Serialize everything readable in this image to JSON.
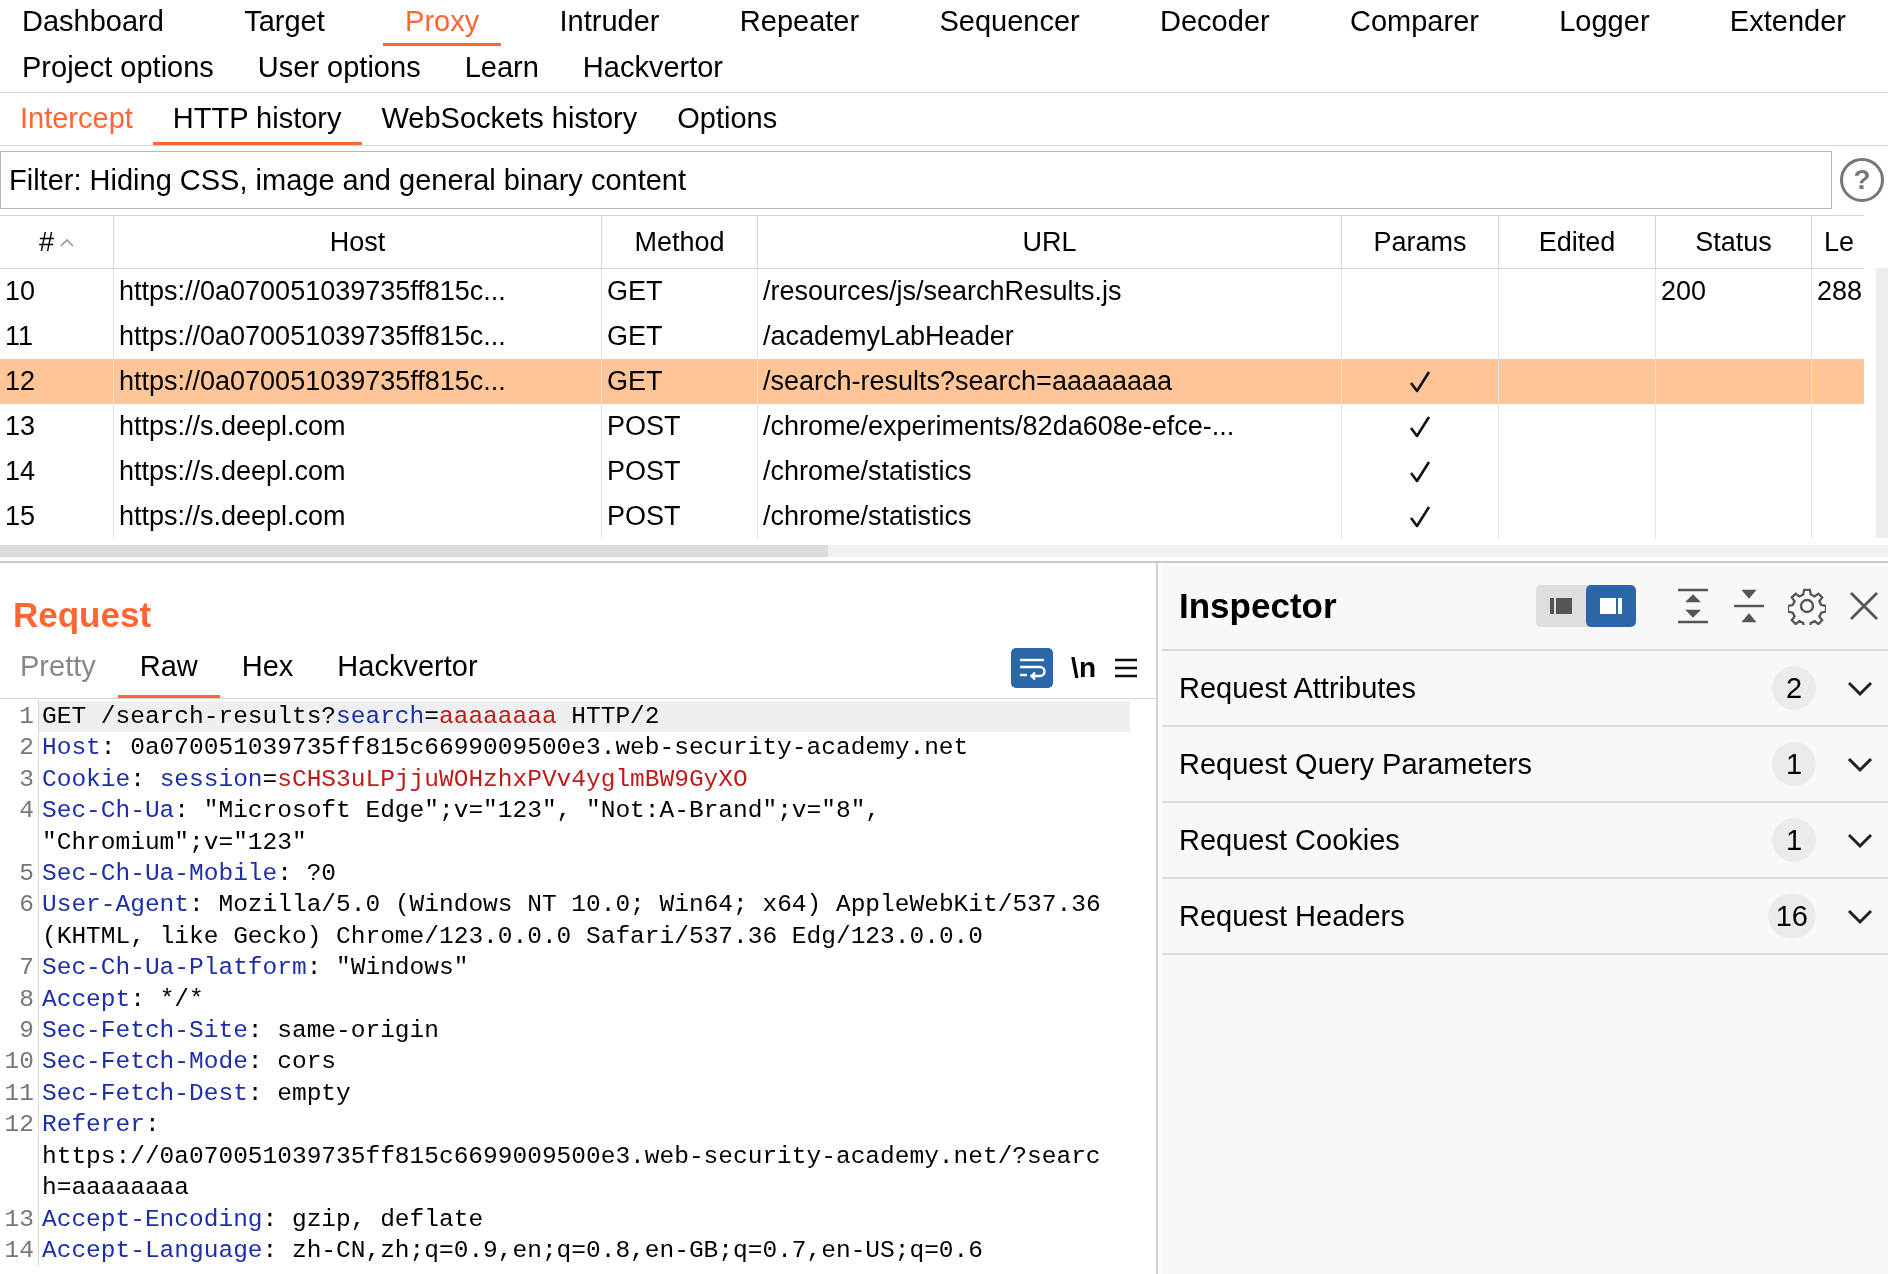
{
  "main_tabs": {
    "rows": [
      {
        "tabs": [
          {
            "label": "Dashboard",
            "selected": false
          },
          {
            "label": "Target",
            "selected": false
          },
          {
            "label": "Proxy",
            "selected": true
          },
          {
            "label": "Intruder",
            "selected": false
          },
          {
            "label": "Repeater",
            "selected": false
          },
          {
            "label": "Sequencer",
            "selected": false
          },
          {
            "label": "Decoder",
            "selected": false
          },
          {
            "label": "Comparer",
            "selected": false
          },
          {
            "label": "Logger",
            "selected": false
          },
          {
            "label": "Extender",
            "selected": false
          }
        ]
      },
      {
        "tabs": [
          {
            "label": "Project options",
            "selected": false
          },
          {
            "label": "User options",
            "selected": false
          },
          {
            "label": "Learn",
            "selected": false
          },
          {
            "label": "Hackvertor",
            "selected": false
          }
        ]
      }
    ]
  },
  "proxy_tabs": [
    {
      "label": "Intercept",
      "selected": false,
      "alert": true
    },
    {
      "label": "HTTP history",
      "selected": true,
      "alert": false
    },
    {
      "label": "WebSockets history",
      "selected": false,
      "alert": false
    },
    {
      "label": "Options",
      "selected": false,
      "alert": false
    }
  ],
  "filter": {
    "text": "Filter: Hiding CSS, image and general binary content",
    "help": "?"
  },
  "history": {
    "columns": [
      {
        "label": "#",
        "sorted": true
      },
      {
        "label": "Host",
        "sorted": false
      },
      {
        "label": "Method",
        "sorted": false
      },
      {
        "label": "URL",
        "sorted": false
      },
      {
        "label": "Params",
        "sorted": false
      },
      {
        "label": "Edited",
        "sorted": false
      },
      {
        "label": "Status",
        "sorted": false
      },
      {
        "label": "Le",
        "sorted": false
      }
    ],
    "rows": [
      {
        "number": "10",
        "host": "https://0a070051039735ff815c...",
        "method": "GET",
        "url": "/resources/js/searchResults.js",
        "params": false,
        "status": "200",
        "length": "288",
        "selected": false
      },
      {
        "number": "11",
        "host": "https://0a070051039735ff815c...",
        "method": "GET",
        "url": "/academyLabHeader",
        "params": false,
        "selected": false
      },
      {
        "number": "12",
        "host": "https://0a070051039735ff815c...",
        "method": "GET",
        "url": "/search-results?search=aaaaaaaa",
        "params": true,
        "selected": true
      },
      {
        "number": "13",
        "host": "https://s.deepl.com",
        "method": "POST",
        "url": "/chrome/experiments/82da608e-efce-...",
        "params": true,
        "selected": false
      },
      {
        "number": "14",
        "host": "https://s.deepl.com",
        "method": "POST",
        "url": "/chrome/statistics",
        "params": true,
        "selected": false
      },
      {
        "number": "15",
        "host": "https://s.deepl.com",
        "method": "POST",
        "url": "/chrome/statistics",
        "params": true,
        "selected": false
      }
    ]
  },
  "request": {
    "title": "Request",
    "tabs": [
      {
        "label": "Pretty",
        "selected": false,
        "disabled": true
      },
      {
        "label": "Raw",
        "selected": true,
        "disabled": false
      },
      {
        "label": "Hex",
        "selected": false,
        "disabled": false
      },
      {
        "label": "Hackvertor",
        "selected": false,
        "disabled": false
      }
    ],
    "wrap_on": true,
    "newline_label": "\\n",
    "lines": [
      {
        "number": "1",
        "current": true,
        "segments": [
          {
            "kind": "plain",
            "text": "GET /search-results?"
          },
          {
            "kind": "param",
            "text": "search"
          },
          {
            "kind": "plain",
            "text": "="
          },
          {
            "kind": "value",
            "text": "aaaaaaaa"
          },
          {
            "kind": "plain",
            "text": " HTTP/2"
          }
        ]
      },
      {
        "number": "2",
        "current": false,
        "segments": [
          {
            "kind": "name",
            "text": "Host"
          },
          {
            "kind": "plain",
            "text": ": 0a070051039735ff815c6699009500e3.web-security-academy.net"
          }
        ]
      },
      {
        "number": "3",
        "current": false,
        "segments": [
          {
            "kind": "name",
            "text": "Cookie"
          },
          {
            "kind": "plain",
            "text": ": "
          },
          {
            "kind": "param",
            "text": "session"
          },
          {
            "kind": "plain",
            "text": "="
          },
          {
            "kind": "value",
            "text": "sCHS3uLPjjuWOHzhxPVv4yglmBW9GyXO"
          }
        ]
      },
      {
        "number": "4",
        "current": false,
        "segments": [
          {
            "kind": "name",
            "text": "Sec-Ch-Ua"
          },
          {
            "kind": "plain",
            "text": ": \"Microsoft Edge\";v=\"123\", \"Not:A-Brand\";v=\"8\", \"Chromium\";v=\"123\""
          }
        ]
      },
      {
        "number": "5",
        "current": false,
        "segments": [
          {
            "kind": "name",
            "text": "Sec-Ch-Ua-Mobile"
          },
          {
            "kind": "plain",
            "text": ": ?0"
          }
        ]
      },
      {
        "number": "6",
        "current": false,
        "segments": [
          {
            "kind": "name",
            "text": "User-Agent"
          },
          {
            "kind": "plain",
            "text": ": Mozilla/5.0 (Windows NT 10.0; Win64; x64) AppleWebKit/537.36 (KHTML, like Gecko) Chrome/123.0.0.0 Safari/537.36 Edg/123.0.0.0"
          }
        ]
      },
      {
        "number": "7",
        "current": false,
        "segments": [
          {
            "kind": "name",
            "text": "Sec-Ch-Ua-Platform"
          },
          {
            "kind": "plain",
            "text": ": \"Windows\""
          }
        ]
      },
      {
        "number": "8",
        "current": false,
        "segments": [
          {
            "kind": "name",
            "text": "Accept"
          },
          {
            "kind": "plain",
            "text": ": */*"
          }
        ]
      },
      {
        "number": "9",
        "current": false,
        "segments": [
          {
            "kind": "name",
            "text": "Sec-Fetch-Site"
          },
          {
            "kind": "plain",
            "text": ": same-origin"
          }
        ]
      },
      {
        "number": "10",
        "current": false,
        "segments": [
          {
            "kind": "name",
            "text": "Sec-Fetch-Mode"
          },
          {
            "kind": "plain",
            "text": ": cors"
          }
        ]
      },
      {
        "number": "11",
        "current": false,
        "segments": [
          {
            "kind": "name",
            "text": "Sec-Fetch-Dest"
          },
          {
            "kind": "plain",
            "text": ": empty"
          }
        ]
      },
      {
        "number": "12",
        "current": false,
        "segments": [
          {
            "kind": "name",
            "text": "Referer"
          },
          {
            "kind": "plain",
            "text": ": https://0a070051039735ff815c6699009500e3.web-security-academy.net/?search=aaaaaaaa"
          }
        ]
      },
      {
        "number": "13",
        "current": false,
        "segments": [
          {
            "kind": "name",
            "text": "Accept-Encoding"
          },
          {
            "kind": "plain",
            "text": ": gzip, deflate"
          }
        ]
      },
      {
        "number": "14",
        "current": false,
        "segments": [
          {
            "kind": "name",
            "text": "Accept-Language"
          },
          {
            "kind": "plain",
            "text": ": zh-CN,zh;q=0.9,en;q=0.8,en-GB;q=0.7,en-US;q=0.6"
          }
        ]
      }
    ]
  },
  "inspector": {
    "title": "Inspector",
    "layout": [
      {
        "selected": false
      },
      {
        "selected": true
      }
    ],
    "sections": [
      {
        "label": "Request Attributes",
        "count": "2",
        "expanded": false
      },
      {
        "label": "Request Query Parameters",
        "count": "1",
        "expanded": false
      },
      {
        "label": "Request Cookies",
        "count": "1",
        "expanded": false
      },
      {
        "label": "Request Headers",
        "count": "16",
        "expanded": false
      }
    ]
  }
}
